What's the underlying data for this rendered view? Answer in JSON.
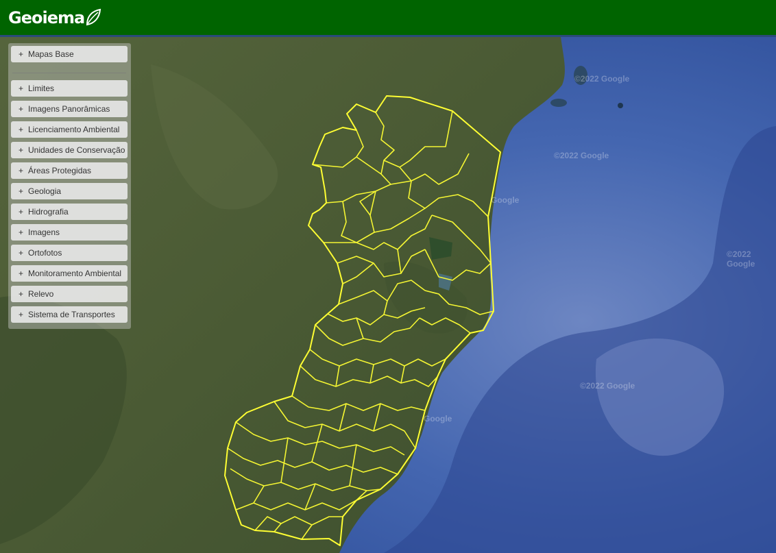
{
  "header": {
    "logo_text": "Geoiema",
    "logo_aria": "Geobases / Geoiema logo"
  },
  "layers_panel": {
    "base_item": {
      "label": "Mapas Base",
      "prefix": "+"
    },
    "items": [
      {
        "label": "Limites",
        "prefix": "+"
      },
      {
        "label": "Imagens Panorâmicas",
        "prefix": "+"
      },
      {
        "label": "Licenciamento Ambiental",
        "prefix": "+"
      },
      {
        "label": "Unidades de Conservação",
        "prefix": "+"
      },
      {
        "label": "Áreas Protegidas",
        "prefix": "+"
      },
      {
        "label": "Geologia",
        "prefix": "+"
      },
      {
        "label": "Hidrografia",
        "prefix": "+"
      },
      {
        "label": "Imagens",
        "prefix": "+"
      },
      {
        "label": "Ortofotos",
        "prefix": "+"
      },
      {
        "label": "Monitoramento Ambiental",
        "prefix": "+"
      },
      {
        "label": "Relevo",
        "prefix": "+"
      },
      {
        "label": "Sistema de Transportes",
        "prefix": "+"
      }
    ]
  },
  "map": {
    "watermarks": [
      "©2022 Google",
      "©2022 Google",
      "Google",
      "©2022 Google",
      "©2022 Google",
      "Google"
    ],
    "colors": {
      "header_green": "#006400",
      "boundary_yellow": "#ffff33",
      "ocean": "#3d5fa8",
      "land": "#4b5a36"
    }
  }
}
